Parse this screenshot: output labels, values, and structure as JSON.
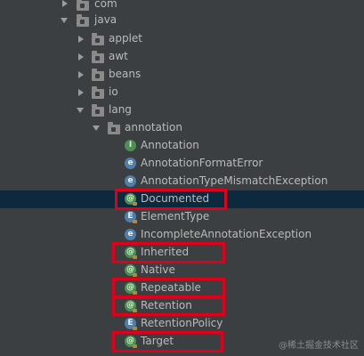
{
  "tree": {
    "items": [
      {
        "label": "com",
        "kind": "folder",
        "state": "collapsed"
      },
      {
        "label": "java",
        "kind": "folder",
        "state": "expanded"
      },
      {
        "label": "applet",
        "kind": "folder",
        "state": "collapsed"
      },
      {
        "label": "awt",
        "kind": "folder",
        "state": "collapsed"
      },
      {
        "label": "beans",
        "kind": "folder",
        "state": "collapsed"
      },
      {
        "label": "io",
        "kind": "folder",
        "state": "collapsed"
      },
      {
        "label": "lang",
        "kind": "folder",
        "state": "expanded"
      },
      {
        "label": "annotation",
        "kind": "folder",
        "state": "expanded"
      },
      {
        "label": "Annotation",
        "kind": "interface",
        "glyph": "I"
      },
      {
        "label": "AnnotationFormatError",
        "kind": "error",
        "glyph": "e"
      },
      {
        "label": "AnnotationTypeMismatchException",
        "kind": "exception",
        "glyph": "e"
      },
      {
        "label": "Documented",
        "kind": "annotation",
        "glyph": "@",
        "selected": true,
        "highlighted": true
      },
      {
        "label": "ElementType",
        "kind": "enum",
        "glyph": "E"
      },
      {
        "label": "IncompleteAnnotationException",
        "kind": "exception",
        "glyph": "e"
      },
      {
        "label": "Inherited",
        "kind": "annotation",
        "glyph": "@",
        "highlighted": true
      },
      {
        "label": "Native",
        "kind": "annotation",
        "glyph": "@"
      },
      {
        "label": "Repeatable",
        "kind": "annotation",
        "glyph": "@",
        "highlighted": true
      },
      {
        "label": "Retention",
        "kind": "annotation",
        "glyph": "@",
        "highlighted": true
      },
      {
        "label": "RetentionPolicy",
        "kind": "enum",
        "glyph": "E"
      },
      {
        "label": "Target",
        "kind": "annotation",
        "glyph": "@",
        "highlighted": true
      }
    ]
  },
  "watermark": {
    "text": "@稀土掘金技术社区"
  },
  "colors": {
    "background": "#3b3f41",
    "selection": "#0d293e",
    "highlight_box": "#e0001a",
    "annotation_icon": "#4e8d54",
    "exception_icon": "#4f7fa8"
  }
}
